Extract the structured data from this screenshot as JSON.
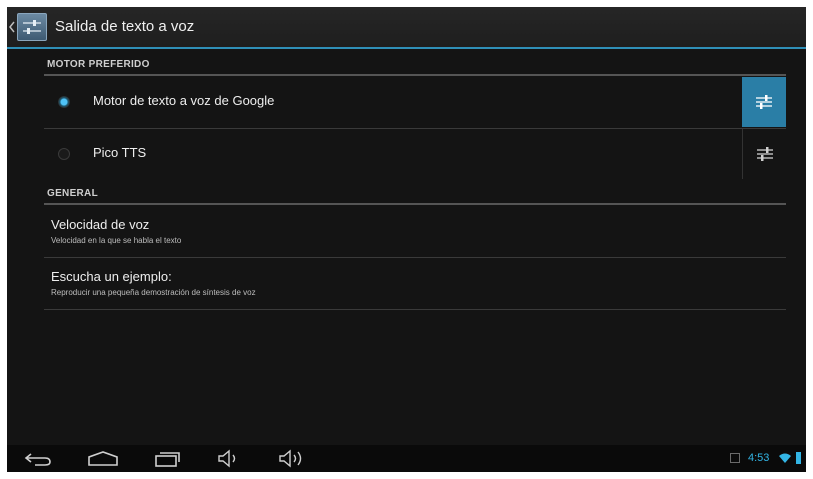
{
  "action_bar": {
    "title": "Salida de texto a voz",
    "app_icon": "settings-sliders-icon",
    "accent_color": "#2f8fb7"
  },
  "sections": {
    "preferred_engine": {
      "header": "MOTOR PREFERIDO",
      "engines": [
        {
          "label": "Motor de texto a voz de Google",
          "selected": true,
          "settings_icon": "sliders-icon"
        },
        {
          "label": "Pico TTS",
          "selected": false,
          "settings_icon": "sliders-icon"
        }
      ]
    },
    "general": {
      "header": "GENERAL",
      "items": [
        {
          "title": "Velocidad de voz",
          "summary": "Velocidad en la que se habla el texto"
        },
        {
          "title": "Escucha un ejemplo:",
          "summary": "Reproducir una pequeña demostración de síntesis de voz"
        }
      ]
    }
  },
  "nav_bar": {
    "buttons": [
      "back-icon",
      "home-icon",
      "recent-apps-icon",
      "volume-down-icon",
      "volume-up-icon"
    ]
  },
  "status": {
    "time": "4:53",
    "time_color": "#33b5e5"
  }
}
